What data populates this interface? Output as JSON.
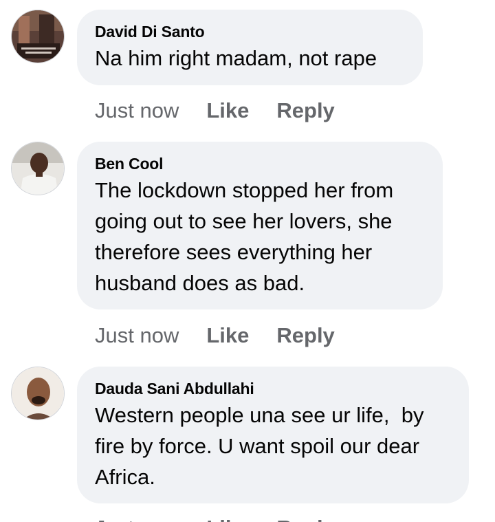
{
  "comments": [
    {
      "author": "David Di Santo",
      "text": "Na him right madam, not rape",
      "time": "Just now",
      "like_label": "Like",
      "reply_label": "Reply"
    },
    {
      "author": "Ben Cool",
      "text": "The lockdown stopped her from going out to see her lovers, she therefore sees everything her husband does as bad.",
      "time": "Just now",
      "like_label": "Like",
      "reply_label": "Reply"
    },
    {
      "author": "Dauda Sani Abdullahi",
      "text": "Western people una see ur life,  by fire by force. U want spoil our dear Africa.",
      "time": "Just now",
      "like_label": "Like",
      "reply_label": "Reply"
    }
  ],
  "colors": {
    "bubble": "#f0f2f5",
    "secondary_text": "#65676b",
    "primary_text": "#050505"
  }
}
